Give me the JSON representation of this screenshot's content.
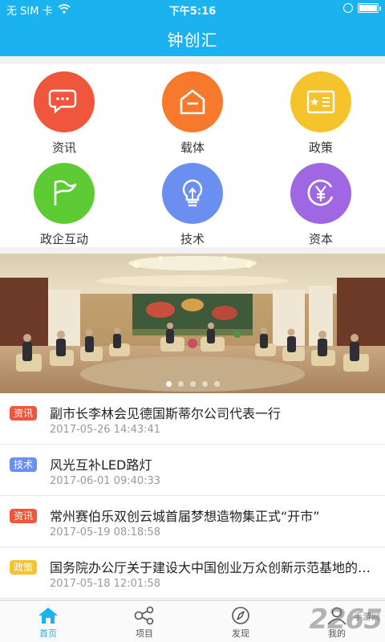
{
  "status_bar": {
    "carrier": "无 SIM 卡",
    "time": "下午5:16"
  },
  "header": {
    "title": "钟创汇"
  },
  "categories": [
    {
      "label": "资讯",
      "color": "#f0563b",
      "icon": "chat-bubbles-icon"
    },
    {
      "label": "载体",
      "color": "#f7792c",
      "icon": "house-icon"
    },
    {
      "label": "政策",
      "color": "#f5c32b",
      "icon": "document-star-icon"
    },
    {
      "label": "政企互动",
      "color": "#5dcc34",
      "icon": "flag-icon"
    },
    {
      "label": "技术",
      "color": "#6b8ff0",
      "icon": "lightbulb-icon"
    },
    {
      "label": "资本",
      "color": "#a067e2",
      "icon": "yen-coin-icon"
    }
  ],
  "banner": {
    "slides": 5,
    "active": 0
  },
  "news": [
    {
      "tag": "资讯",
      "tag_color": "#f0563b",
      "title": "副市长李林会见德国斯蒂尔公司代表一行",
      "time": "2017-05-26 14:43:41"
    },
    {
      "tag": "技术",
      "tag_color": "#6b8ff0",
      "title": "风光互补LED路灯",
      "time": "2017-06-01 09:40:33"
    },
    {
      "tag": "资讯",
      "tag_color": "#f0563b",
      "title": "常州赛伯乐双创云城首届梦想造物集正式“开市”",
      "time": "2017-05-19 08:18:58"
    },
    {
      "tag": "政策",
      "tag_color": "#f5c32b",
      "title": "国务院办公厅关于建设大中国创业万众创新示范基地的实施意见",
      "time": "2017-05-18 12:01:58"
    }
  ],
  "tabs": [
    {
      "label": "首页",
      "icon": "home-icon",
      "active": true
    },
    {
      "label": "项目",
      "icon": "nodes-icon",
      "active": false
    },
    {
      "label": "发现",
      "icon": "compass-icon",
      "active": false
    },
    {
      "label": "我的",
      "icon": "user-icon",
      "active": false
    }
  ],
  "watermark": {
    "number": "2265",
    "site": "手游网"
  },
  "colors": {
    "accent": "#1ab3f0",
    "background": "#f2f2f2"
  }
}
